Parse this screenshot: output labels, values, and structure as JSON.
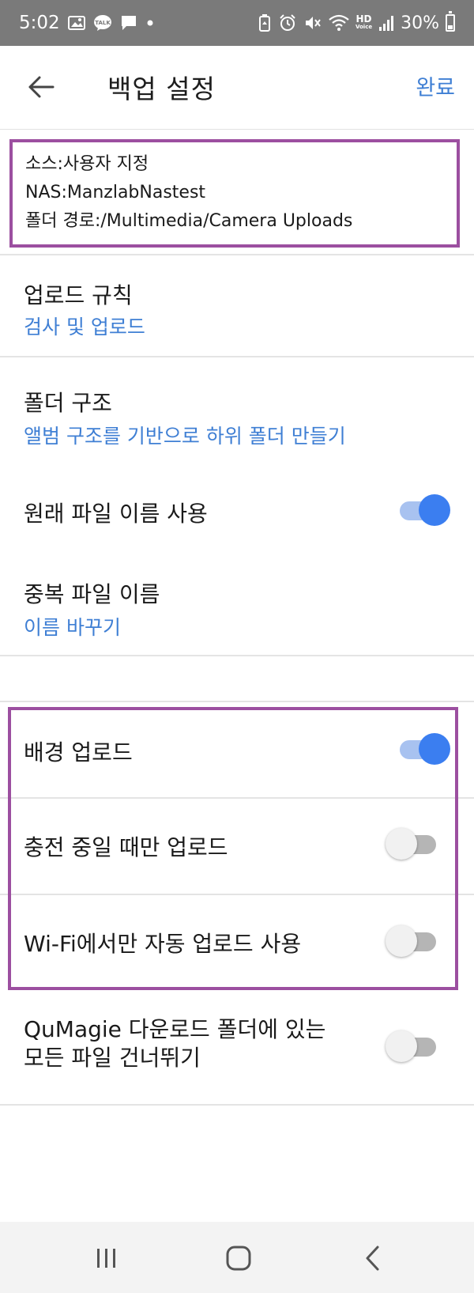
{
  "status_bar": {
    "time": "5:02",
    "hd_top": "HD",
    "hd_bottom": "Voice",
    "battery_percent": "30%",
    "battery_level": 0.3
  },
  "app_bar": {
    "title": "백업 설정",
    "done_label": "완료"
  },
  "source": {
    "source_line": "소스:사용자 지정",
    "nas_line": "NAS:ManzlabNastest",
    "path_line": "폴더 경로:/Multimedia/Camera Uploads"
  },
  "settings": {
    "upload_rule": {
      "title": "업로드 규칙",
      "value": "검사 및 업로드"
    },
    "folder_structure": {
      "title": "폴더 구조",
      "value": "앨범 구조를 기반으로 하위 폴더 만들기"
    },
    "original_filename": {
      "title": "원래 파일 이름 사용",
      "enabled": true
    },
    "duplicate_filename": {
      "title": "중복 파일 이름",
      "value": "이름 바꾸기"
    },
    "background_upload": {
      "title": "배경 업로드",
      "enabled": true
    },
    "charging_only": {
      "title": "충전 중일 때만 업로드",
      "enabled": false
    },
    "wifi_only": {
      "title": "Wi-Fi에서만 자동 업로드 사용",
      "enabled": false
    },
    "skip_download_folder": {
      "title_line1": "QuMagie 다운로드 폴더에 있는",
      "title_line2": "모든 파일 건너뛰기",
      "enabled": false
    }
  },
  "colors": {
    "accent": "#3f7fd4",
    "toggle_on": "#3b7ef0",
    "highlight": "#9c4fa0"
  }
}
